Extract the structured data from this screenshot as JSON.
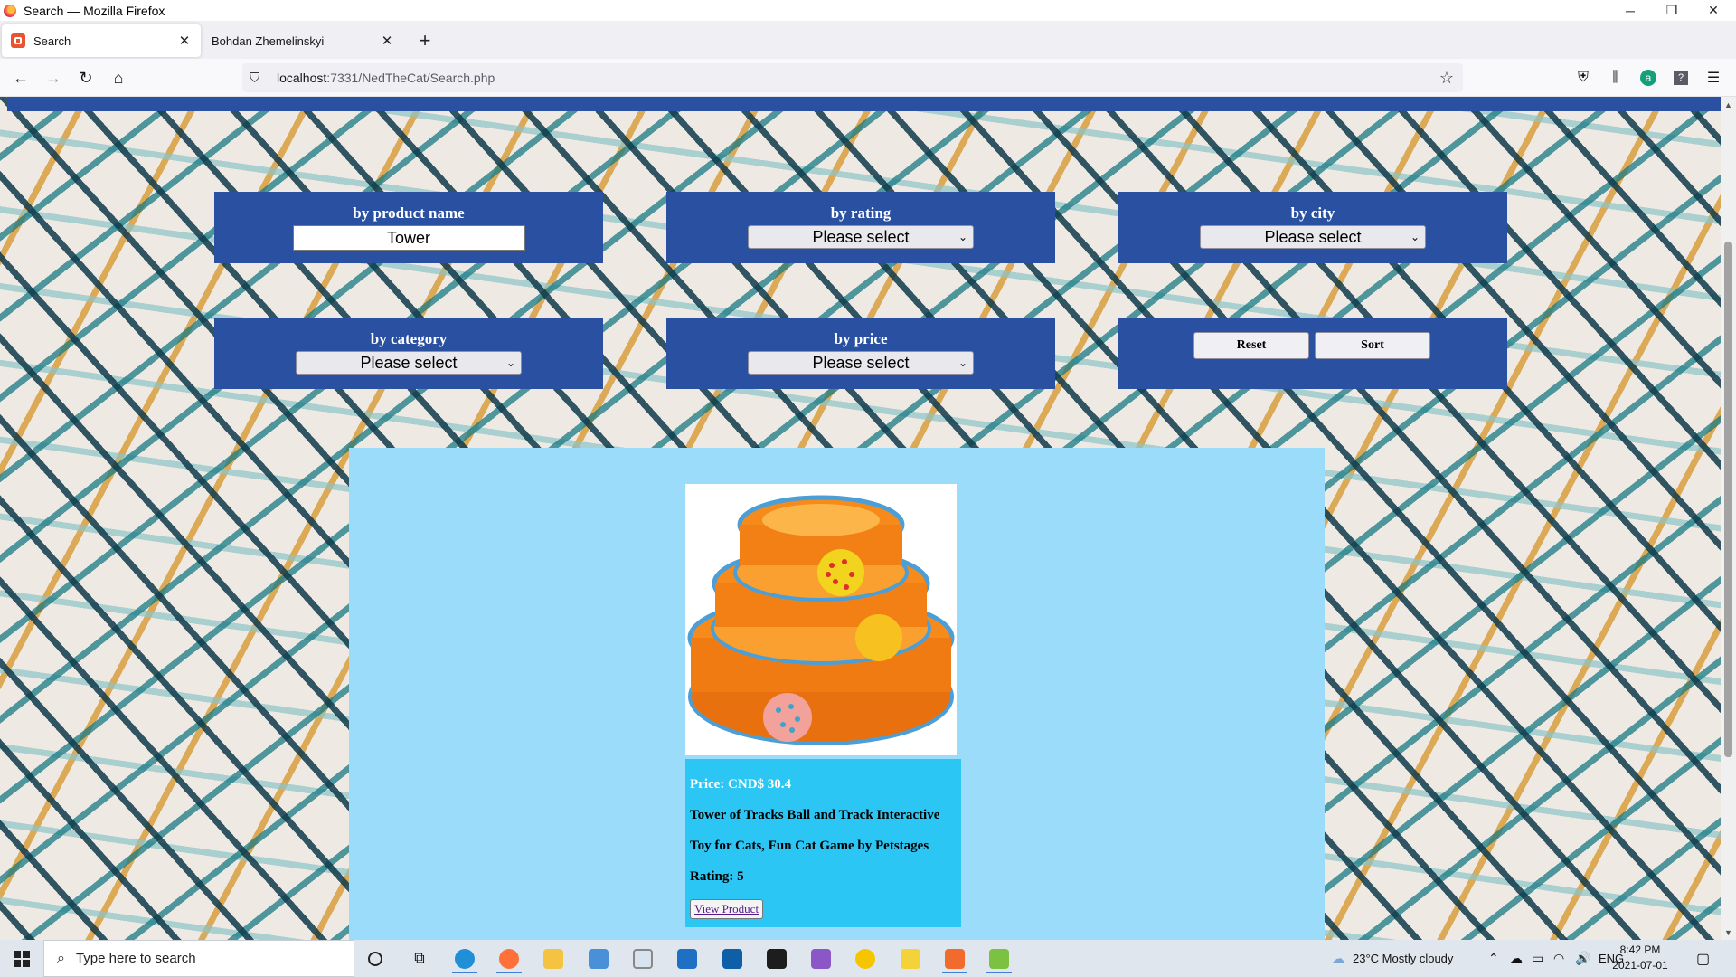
{
  "window": {
    "title": "Search — Mozilla Firefox",
    "controls": {
      "minimize": "─",
      "restore": "❐",
      "close": "✕"
    }
  },
  "tabs": [
    {
      "label": "Search",
      "active": true
    },
    {
      "label": "Bohdan Zhemelinskyi",
      "active": false
    }
  ],
  "navbar": {
    "url_host": "localhost",
    "url_path": ":7331/NedTheCat/Search.php"
  },
  "filters": {
    "product_name": {
      "label": "by product name",
      "value": "Tower"
    },
    "rating": {
      "label": "by rating",
      "selected": "Please select"
    },
    "city": {
      "label": "by city",
      "selected": "Please select"
    },
    "category": {
      "label": "by category",
      "selected": "Please select"
    },
    "price": {
      "label": "by price",
      "selected": "Please select"
    },
    "reset_label": "Reset",
    "sort_label": "Sort"
  },
  "product": {
    "price": "Price: CND$ 30.4",
    "title_line1": "Tower of Tracks Ball and Track Interactive",
    "title_line2": "Toy for Cats, Fun Cat Game by Petstages",
    "rating": "Rating: 5",
    "view_label": "View Product"
  },
  "taskbar": {
    "search_placeholder": "Type here to search",
    "weather": "23°C  Mostly cloudy",
    "language": "ENG",
    "time": "8:42 PM",
    "date": "2021-07-01"
  },
  "colors": {
    "filter_panel": "#2a50a2",
    "results_panel": "#9adcf9",
    "product_info": "#2cc6f4"
  }
}
